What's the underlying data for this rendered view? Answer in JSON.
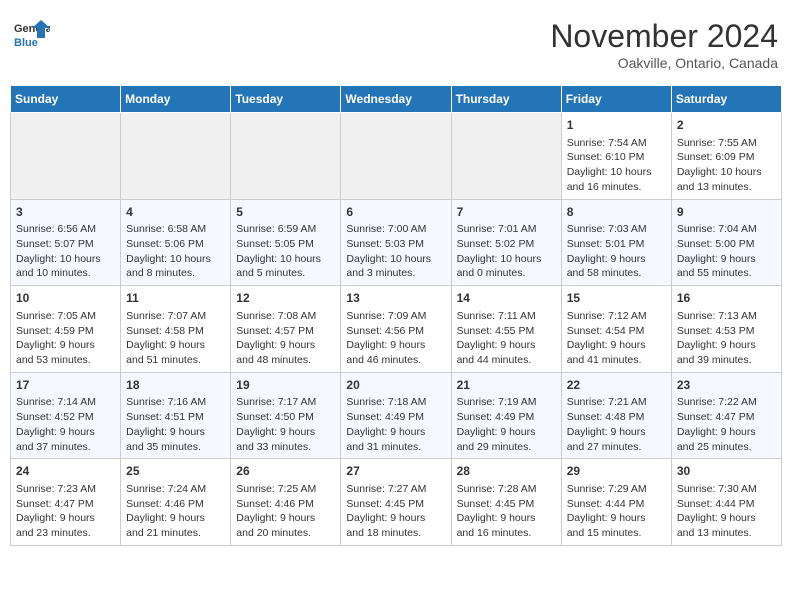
{
  "logo": {
    "line1": "General",
    "line2": "Blue"
  },
  "title": "November 2024",
  "location": "Oakville, Ontario, Canada",
  "days_header": [
    "Sunday",
    "Monday",
    "Tuesday",
    "Wednesday",
    "Thursday",
    "Friday",
    "Saturday"
  ],
  "weeks": [
    [
      {
        "day": "",
        "empty": true
      },
      {
        "day": "",
        "empty": true
      },
      {
        "day": "",
        "empty": true
      },
      {
        "day": "",
        "empty": true
      },
      {
        "day": "",
        "empty": true
      },
      {
        "day": "1",
        "sunrise": "Sunrise: 7:54 AM",
        "sunset": "Sunset: 6:10 PM",
        "daylight": "Daylight: 10 hours and 16 minutes."
      },
      {
        "day": "2",
        "sunrise": "Sunrise: 7:55 AM",
        "sunset": "Sunset: 6:09 PM",
        "daylight": "Daylight: 10 hours and 13 minutes."
      }
    ],
    [
      {
        "day": "3",
        "sunrise": "Sunrise: 6:56 AM",
        "sunset": "Sunset: 5:07 PM",
        "daylight": "Daylight: 10 hours and 10 minutes."
      },
      {
        "day": "4",
        "sunrise": "Sunrise: 6:58 AM",
        "sunset": "Sunset: 5:06 PM",
        "daylight": "Daylight: 10 hours and 8 minutes."
      },
      {
        "day": "5",
        "sunrise": "Sunrise: 6:59 AM",
        "sunset": "Sunset: 5:05 PM",
        "daylight": "Daylight: 10 hours and 5 minutes."
      },
      {
        "day": "6",
        "sunrise": "Sunrise: 7:00 AM",
        "sunset": "Sunset: 5:03 PM",
        "daylight": "Daylight: 10 hours and 3 minutes."
      },
      {
        "day": "7",
        "sunrise": "Sunrise: 7:01 AM",
        "sunset": "Sunset: 5:02 PM",
        "daylight": "Daylight: 10 hours and 0 minutes."
      },
      {
        "day": "8",
        "sunrise": "Sunrise: 7:03 AM",
        "sunset": "Sunset: 5:01 PM",
        "daylight": "Daylight: 9 hours and 58 minutes."
      },
      {
        "day": "9",
        "sunrise": "Sunrise: 7:04 AM",
        "sunset": "Sunset: 5:00 PM",
        "daylight": "Daylight: 9 hours and 55 minutes."
      }
    ],
    [
      {
        "day": "10",
        "sunrise": "Sunrise: 7:05 AM",
        "sunset": "Sunset: 4:59 PM",
        "daylight": "Daylight: 9 hours and 53 minutes."
      },
      {
        "day": "11",
        "sunrise": "Sunrise: 7:07 AM",
        "sunset": "Sunset: 4:58 PM",
        "daylight": "Daylight: 9 hours and 51 minutes."
      },
      {
        "day": "12",
        "sunrise": "Sunrise: 7:08 AM",
        "sunset": "Sunset: 4:57 PM",
        "daylight": "Daylight: 9 hours and 48 minutes."
      },
      {
        "day": "13",
        "sunrise": "Sunrise: 7:09 AM",
        "sunset": "Sunset: 4:56 PM",
        "daylight": "Daylight: 9 hours and 46 minutes."
      },
      {
        "day": "14",
        "sunrise": "Sunrise: 7:11 AM",
        "sunset": "Sunset: 4:55 PM",
        "daylight": "Daylight: 9 hours and 44 minutes."
      },
      {
        "day": "15",
        "sunrise": "Sunrise: 7:12 AM",
        "sunset": "Sunset: 4:54 PM",
        "daylight": "Daylight: 9 hours and 41 minutes."
      },
      {
        "day": "16",
        "sunrise": "Sunrise: 7:13 AM",
        "sunset": "Sunset: 4:53 PM",
        "daylight": "Daylight: 9 hours and 39 minutes."
      }
    ],
    [
      {
        "day": "17",
        "sunrise": "Sunrise: 7:14 AM",
        "sunset": "Sunset: 4:52 PM",
        "daylight": "Daylight: 9 hours and 37 minutes."
      },
      {
        "day": "18",
        "sunrise": "Sunrise: 7:16 AM",
        "sunset": "Sunset: 4:51 PM",
        "daylight": "Daylight: 9 hours and 35 minutes."
      },
      {
        "day": "19",
        "sunrise": "Sunrise: 7:17 AM",
        "sunset": "Sunset: 4:50 PM",
        "daylight": "Daylight: 9 hours and 33 minutes."
      },
      {
        "day": "20",
        "sunrise": "Sunrise: 7:18 AM",
        "sunset": "Sunset: 4:49 PM",
        "daylight": "Daylight: 9 hours and 31 minutes."
      },
      {
        "day": "21",
        "sunrise": "Sunrise: 7:19 AM",
        "sunset": "Sunset: 4:49 PM",
        "daylight": "Daylight: 9 hours and 29 minutes."
      },
      {
        "day": "22",
        "sunrise": "Sunrise: 7:21 AM",
        "sunset": "Sunset: 4:48 PM",
        "daylight": "Daylight: 9 hours and 27 minutes."
      },
      {
        "day": "23",
        "sunrise": "Sunrise: 7:22 AM",
        "sunset": "Sunset: 4:47 PM",
        "daylight": "Daylight: 9 hours and 25 minutes."
      }
    ],
    [
      {
        "day": "24",
        "sunrise": "Sunrise: 7:23 AM",
        "sunset": "Sunset: 4:47 PM",
        "daylight": "Daylight: 9 hours and 23 minutes."
      },
      {
        "day": "25",
        "sunrise": "Sunrise: 7:24 AM",
        "sunset": "Sunset: 4:46 PM",
        "daylight": "Daylight: 9 hours and 21 minutes."
      },
      {
        "day": "26",
        "sunrise": "Sunrise: 7:25 AM",
        "sunset": "Sunset: 4:46 PM",
        "daylight": "Daylight: 9 hours and 20 minutes."
      },
      {
        "day": "27",
        "sunrise": "Sunrise: 7:27 AM",
        "sunset": "Sunset: 4:45 PM",
        "daylight": "Daylight: 9 hours and 18 minutes."
      },
      {
        "day": "28",
        "sunrise": "Sunrise: 7:28 AM",
        "sunset": "Sunset: 4:45 PM",
        "daylight": "Daylight: 9 hours and 16 minutes."
      },
      {
        "day": "29",
        "sunrise": "Sunrise: 7:29 AM",
        "sunset": "Sunset: 4:44 PM",
        "daylight": "Daylight: 9 hours and 15 minutes."
      },
      {
        "day": "30",
        "sunrise": "Sunrise: 7:30 AM",
        "sunset": "Sunset: 4:44 PM",
        "daylight": "Daylight: 9 hours and 13 minutes."
      }
    ]
  ]
}
